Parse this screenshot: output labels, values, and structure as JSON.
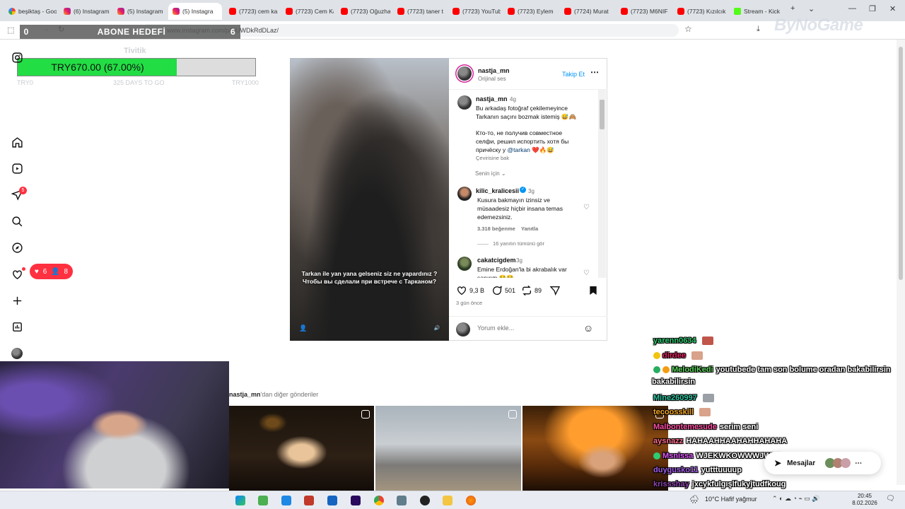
{
  "browser": {
    "tabs": [
      {
        "label": "beşiktaş - Goo",
        "icon": "google-icon"
      },
      {
        "label": "(6) Instagram",
        "icon": "instagram-icon"
      },
      {
        "label": "(5) Instagram",
        "icon": "instagram-icon"
      },
      {
        "label": "(5) Instagra",
        "icon": "instagram-icon",
        "active": true
      },
      {
        "label": "(7723) cem ka",
        "icon": "youtube-icon"
      },
      {
        "label": "(7723) Cem Ka",
        "icon": "youtube-icon"
      },
      {
        "label": "(7723) Oğuzha",
        "icon": "youtube-icon"
      },
      {
        "label": "(7723) taner t",
        "icon": "youtube-icon"
      },
      {
        "label": "(7723) YouTub",
        "icon": "youtube-icon"
      },
      {
        "label": "(7723) Eylem",
        "icon": "youtube-icon"
      },
      {
        "label": "(7724) Murat",
        "icon": "youtube-icon"
      },
      {
        "label": "(7723) M6NIF",
        "icon": "youtube-icon"
      },
      {
        "label": "(7723) Kızılcık",
        "icon": "youtube-icon"
      },
      {
        "label": "Stream - Kick",
        "icon": "kick-icon"
      }
    ],
    "new_tab": "+",
    "url": "www.instagram.com/p/DUWDkRdDLaz/"
  },
  "overlay": {
    "sub_goal_left": "0",
    "sub_goal_title": "ABONE HEDEFİ",
    "sub_goal_right": "6",
    "donation_title": "Tivitik",
    "donation_text": "TRY670.00 (67.00%)",
    "donation_progress": 67.0,
    "donation_min": "TRY0",
    "donation_mid": "325 DAYS TO GO",
    "donation_max": "TRY1000",
    "watermark": "ByNoGame"
  },
  "ig": {
    "notif_count": "5",
    "likes_count": "6",
    "followers_count": "8",
    "post": {
      "username": "nastja_mn",
      "audio": "Orijinal ses",
      "follow": "Takip Et",
      "video_caption_tr": "Tarkan ile yan yana gelseniz siz ne yapardınız ?",
      "video_caption_ru": "Чтобы вы сделали при встрече с Тарканом?",
      "caption_user": "nastja_mn",
      "caption_time": "4g",
      "caption_tr": "Bu arkadaş fotoğraf çekilemeyince Tarkanın saçını bozmak istemiş 😅🙈",
      "caption_ru": "Кто-то, не получив совместное селфи, решил испортить хотя бы причёску у",
      "caption_mention": "@tarkan",
      "caption_ru_end": "❤️🔥😅",
      "translate": "Çevirisine bak",
      "for_you": "Senin için",
      "comments": [
        {
          "user": "kilic_kralicesii",
          "time": "3g",
          "text": "Kusura bakmayın izinsiz ve müsaadesiz hiçbir insana temas edemezsiniz.",
          "likes": "3.318 beğenme",
          "reply": "Yanıtla",
          "see_replies": "16 yanıtın tümünü gör"
        },
        {
          "user": "cakatcigdem",
          "time": "3g",
          "text": "Emine Erdoğan'la bi akrabalık var sanırım 😂😂"
        }
      ],
      "like_count": "9,3 B",
      "comment_count": "501",
      "repost_count": "89",
      "date": "3 gün önce",
      "comment_placeholder": "Yorum ekle..."
    },
    "more_posts_user": "nastja_mn",
    "more_posts_suffix": "'dan diğer gönderiler",
    "messages": "Mesajlar"
  },
  "chat": [
    {
      "name": "yarenn0634",
      "color": "#2ecc71",
      "text": ""
    },
    {
      "name": "dirdee",
      "color": "#e91e63",
      "text": ""
    },
    {
      "name": "MelodiKedi",
      "color": "#5bd35b",
      "text": "youtubede tam son bolume oradan bakabilirsin"
    },
    {
      "name": "Mine260997",
      "color": "#2ec4a0",
      "text": ""
    },
    {
      "name": "tecoosskill",
      "color": "#f5a623",
      "text": ""
    },
    {
      "name": "Malbontemesude",
      "color": "#ff4fa3",
      "text": "serim seni"
    },
    {
      "name": "aysnazz",
      "color": "#ff6b8a",
      "text": "HAHAAHHAAHAHHAHAHA"
    },
    {
      "name": "Msnissa",
      "color": "#e056fd",
      "text": "WJEKWKOWWWJWJA"
    },
    {
      "name": "duygusko11",
      "color": "#a55eea",
      "text": "yutttuuuup"
    },
    {
      "name": "krissshay",
      "color": "#8e44ad",
      "text": "jxcykfulgışlfukyjtudfkoug"
    }
  ],
  "taskbar": {
    "weather": "10°C  Hafif yağmur",
    "time": "20:45",
    "date": "8.02.2026"
  }
}
